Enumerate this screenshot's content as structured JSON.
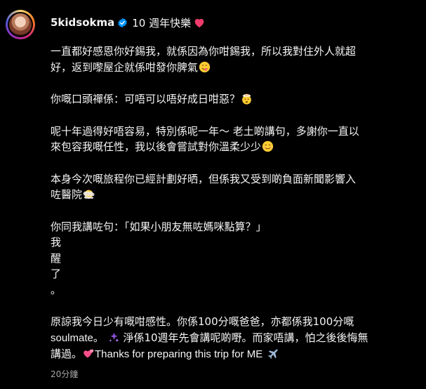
{
  "post": {
    "username": "5kidsokma",
    "caption_head": "10 週年快樂",
    "paragraphs": [
      [
        "一直都好感恩你好錫我，就係因為你咁錫我，所以我對住外人就超",
        "好，返到嚟屋企就係咁發你脾氣"
      ],
      [
        "你嘅口頭禪係：可唔可以唔好成日咁惡？"
      ],
      [
        "呢十年過得好唔容易，特別係呢一年～ 老土啲講句，多謝你一直以",
        "來包容我嘅任性，我以後會嘗試對你溫柔少少"
      ],
      [
        "本身今次嘅旅程你已經計劃好晒，但係我又受到啲負面新聞影響入",
        "咗醫院"
      ],
      [
        "你同我講咗句：「如果小朋友無咗媽咪點算？」",
        "我",
        "醒",
        "了",
        "。"
      ],
      [
        "原諒我今日少有嘅咁感性。你係100分嘅爸爸，亦都係我100分嘅",
        "soulmate。",
        "淨係10週年先會講呢啲嘢。而家唔講，怕之後後悔無",
        "講過。",
        "Thanks for preparing this trip for ME"
      ]
    ],
    "emojis": [
      "red-heart",
      "face-savoring",
      "exploding-head",
      "smiling-face",
      "face-in-clouds",
      "sparkles",
      "two-hearts",
      "airplane"
    ],
    "timestamp": "20分鐘"
  }
}
